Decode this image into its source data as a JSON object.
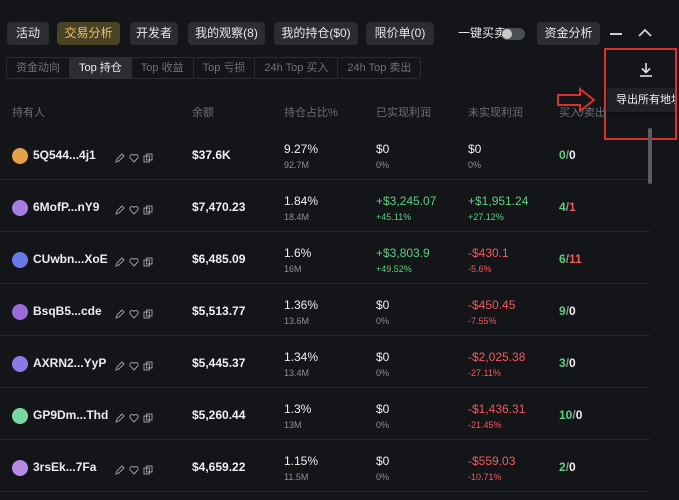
{
  "top_tabs": [
    {
      "label": "活动",
      "active": false
    },
    {
      "label": "交易分析",
      "active": true
    },
    {
      "label": "开发者",
      "active": false
    },
    {
      "label": "我的观察(8)",
      "active": false
    },
    {
      "label": "我的持仓($0)",
      "active": false
    },
    {
      "label": "限价单(0)",
      "active": false
    }
  ],
  "one_click": {
    "label": "一键买卖",
    "enabled": false
  },
  "fund_analysis_label": "资金分析",
  "sub_tabs": [
    {
      "label": "资金动向",
      "active": false
    },
    {
      "label": "Top 持仓",
      "active": true
    },
    {
      "label": "Top 收益",
      "active": false
    },
    {
      "label": "Top 亏损",
      "active": false
    },
    {
      "label": "24h Top 买入",
      "active": false
    },
    {
      "label": "24h Top 卖出",
      "active": false
    }
  ],
  "export": {
    "tooltip": "导出所有地址",
    "icon": "download-icon"
  },
  "columns": {
    "holder": "持有人",
    "balance": "余额",
    "share": "持仓占比%",
    "realized": "已实现利润",
    "unrealized": "未实现利润",
    "buy_sell": "买入/卖出"
  },
  "colors": {
    "accent": "#e8c36a",
    "positive": "#5fcf80",
    "negative": "#ef5a5f",
    "annotation": "#d9312c"
  },
  "rows": [
    {
      "avatar_color": "#e6a04a",
      "address": "5Q544...4j1",
      "balance": "$37.6K",
      "share": "9.27%",
      "share_amount": "92.7M",
      "realized": "$0",
      "realized_pct": "0%",
      "realized_tone": "neutral",
      "unrealized": "$0",
      "unrealized_pct": "0%",
      "unrealized_tone": "neutral",
      "buy": "0",
      "sell": "0",
      "sell_tone": "white"
    },
    {
      "avatar_color": "#a77ce0",
      "address": "6MofP...nY9",
      "balance": "$7,470.23",
      "share": "1.84%",
      "share_amount": "18.4M",
      "realized": "+$3,245.07",
      "realized_pct": "+45.11%",
      "realized_tone": "positive",
      "unrealized": "+$1,951.24",
      "unrealized_pct": "+27.12%",
      "unrealized_tone": "positive",
      "buy": "4",
      "sell": "1",
      "sell_tone": "negative"
    },
    {
      "avatar_color": "#6a78e8",
      "address": "CUwbn...XoE",
      "balance": "$6,485.09",
      "share": "1.6%",
      "share_amount": "16M",
      "realized": "+$3,803.9",
      "realized_pct": "+49.52%",
      "realized_tone": "positive",
      "unrealized": "-$430.1",
      "unrealized_pct": "-5.6%",
      "unrealized_tone": "negative",
      "buy": "6",
      "sell": "11",
      "sell_tone": "negative"
    },
    {
      "avatar_color": "#9a6ad8",
      "address": "BsqB5...cde",
      "balance": "$5,513.77",
      "share": "1.36%",
      "share_amount": "13.6M",
      "realized": "$0",
      "realized_pct": "0%",
      "realized_tone": "neutral",
      "unrealized": "-$450.45",
      "unrealized_pct": "-7.55%",
      "unrealized_tone": "negative",
      "buy": "9",
      "sell": "0",
      "sell_tone": "white"
    },
    {
      "avatar_color": "#8a7ae8",
      "address": "AXRN2...YyP",
      "balance": "$5,445.37",
      "share": "1.34%",
      "share_amount": "13.4M",
      "realized": "$0",
      "realized_pct": "0%",
      "realized_tone": "neutral",
      "unrealized": "-$2,025.38",
      "unrealized_pct": "-27.11%",
      "unrealized_tone": "negative",
      "buy": "3",
      "sell": "0",
      "sell_tone": "white"
    },
    {
      "avatar_color": "#7ad6a0",
      "address": "GP9Dm...Thd",
      "balance": "$5,260.44",
      "share": "1.3%",
      "share_amount": "13M",
      "realized": "$0",
      "realized_pct": "0%",
      "realized_tone": "neutral",
      "unrealized": "-$1,436.31",
      "unrealized_pct": "-21.45%",
      "unrealized_tone": "negative",
      "buy": "10",
      "sell": "0",
      "sell_tone": "white"
    },
    {
      "avatar_color": "#b58ae0",
      "address": "3rsEk...7Fa",
      "balance": "$4,659.22",
      "share": "1.15%",
      "share_amount": "11.5M",
      "realized": "$0",
      "realized_pct": "0%",
      "realized_tone": "neutral",
      "unrealized": "-$559.03",
      "unrealized_pct": "-10.71%",
      "unrealized_tone": "negative",
      "buy": "2",
      "sell": "0",
      "sell_tone": "white"
    }
  ]
}
